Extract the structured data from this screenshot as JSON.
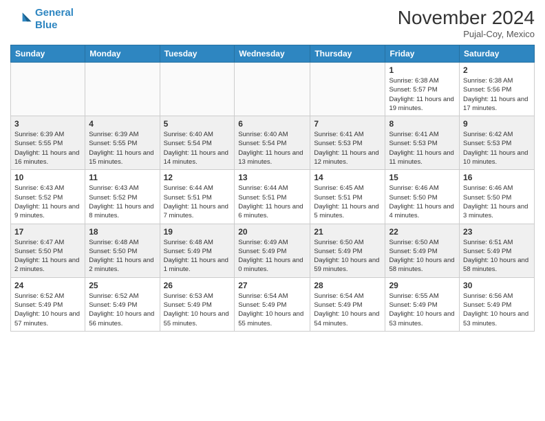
{
  "header": {
    "logo_line1": "General",
    "logo_line2": "Blue",
    "month": "November 2024",
    "location": "Pujal-Coy, Mexico"
  },
  "days_of_week": [
    "Sunday",
    "Monday",
    "Tuesday",
    "Wednesday",
    "Thursday",
    "Friday",
    "Saturday"
  ],
  "weeks": [
    [
      {
        "num": "",
        "info": ""
      },
      {
        "num": "",
        "info": ""
      },
      {
        "num": "",
        "info": ""
      },
      {
        "num": "",
        "info": ""
      },
      {
        "num": "",
        "info": ""
      },
      {
        "num": "1",
        "info": "Sunrise: 6:38 AM\nSunset: 5:57 PM\nDaylight: 11 hours and 19 minutes."
      },
      {
        "num": "2",
        "info": "Sunrise: 6:38 AM\nSunset: 5:56 PM\nDaylight: 11 hours and 17 minutes."
      }
    ],
    [
      {
        "num": "3",
        "info": "Sunrise: 6:39 AM\nSunset: 5:55 PM\nDaylight: 11 hours and 16 minutes."
      },
      {
        "num": "4",
        "info": "Sunrise: 6:39 AM\nSunset: 5:55 PM\nDaylight: 11 hours and 15 minutes."
      },
      {
        "num": "5",
        "info": "Sunrise: 6:40 AM\nSunset: 5:54 PM\nDaylight: 11 hours and 14 minutes."
      },
      {
        "num": "6",
        "info": "Sunrise: 6:40 AM\nSunset: 5:54 PM\nDaylight: 11 hours and 13 minutes."
      },
      {
        "num": "7",
        "info": "Sunrise: 6:41 AM\nSunset: 5:53 PM\nDaylight: 11 hours and 12 minutes."
      },
      {
        "num": "8",
        "info": "Sunrise: 6:41 AM\nSunset: 5:53 PM\nDaylight: 11 hours and 11 minutes."
      },
      {
        "num": "9",
        "info": "Sunrise: 6:42 AM\nSunset: 5:53 PM\nDaylight: 11 hours and 10 minutes."
      }
    ],
    [
      {
        "num": "10",
        "info": "Sunrise: 6:43 AM\nSunset: 5:52 PM\nDaylight: 11 hours and 9 minutes."
      },
      {
        "num": "11",
        "info": "Sunrise: 6:43 AM\nSunset: 5:52 PM\nDaylight: 11 hours and 8 minutes."
      },
      {
        "num": "12",
        "info": "Sunrise: 6:44 AM\nSunset: 5:51 PM\nDaylight: 11 hours and 7 minutes."
      },
      {
        "num": "13",
        "info": "Sunrise: 6:44 AM\nSunset: 5:51 PM\nDaylight: 11 hours and 6 minutes."
      },
      {
        "num": "14",
        "info": "Sunrise: 6:45 AM\nSunset: 5:51 PM\nDaylight: 11 hours and 5 minutes."
      },
      {
        "num": "15",
        "info": "Sunrise: 6:46 AM\nSunset: 5:50 PM\nDaylight: 11 hours and 4 minutes."
      },
      {
        "num": "16",
        "info": "Sunrise: 6:46 AM\nSunset: 5:50 PM\nDaylight: 11 hours and 3 minutes."
      }
    ],
    [
      {
        "num": "17",
        "info": "Sunrise: 6:47 AM\nSunset: 5:50 PM\nDaylight: 11 hours and 2 minutes."
      },
      {
        "num": "18",
        "info": "Sunrise: 6:48 AM\nSunset: 5:50 PM\nDaylight: 11 hours and 2 minutes."
      },
      {
        "num": "19",
        "info": "Sunrise: 6:48 AM\nSunset: 5:49 PM\nDaylight: 11 hours and 1 minute."
      },
      {
        "num": "20",
        "info": "Sunrise: 6:49 AM\nSunset: 5:49 PM\nDaylight: 11 hours and 0 minutes."
      },
      {
        "num": "21",
        "info": "Sunrise: 6:50 AM\nSunset: 5:49 PM\nDaylight: 10 hours and 59 minutes."
      },
      {
        "num": "22",
        "info": "Sunrise: 6:50 AM\nSunset: 5:49 PM\nDaylight: 10 hours and 58 minutes."
      },
      {
        "num": "23",
        "info": "Sunrise: 6:51 AM\nSunset: 5:49 PM\nDaylight: 10 hours and 58 minutes."
      }
    ],
    [
      {
        "num": "24",
        "info": "Sunrise: 6:52 AM\nSunset: 5:49 PM\nDaylight: 10 hours and 57 minutes."
      },
      {
        "num": "25",
        "info": "Sunrise: 6:52 AM\nSunset: 5:49 PM\nDaylight: 10 hours and 56 minutes."
      },
      {
        "num": "26",
        "info": "Sunrise: 6:53 AM\nSunset: 5:49 PM\nDaylight: 10 hours and 55 minutes."
      },
      {
        "num": "27",
        "info": "Sunrise: 6:54 AM\nSunset: 5:49 PM\nDaylight: 10 hours and 55 minutes."
      },
      {
        "num": "28",
        "info": "Sunrise: 6:54 AM\nSunset: 5:49 PM\nDaylight: 10 hours and 54 minutes."
      },
      {
        "num": "29",
        "info": "Sunrise: 6:55 AM\nSunset: 5:49 PM\nDaylight: 10 hours and 53 minutes."
      },
      {
        "num": "30",
        "info": "Sunrise: 6:56 AM\nSunset: 5:49 PM\nDaylight: 10 hours and 53 minutes."
      }
    ]
  ]
}
